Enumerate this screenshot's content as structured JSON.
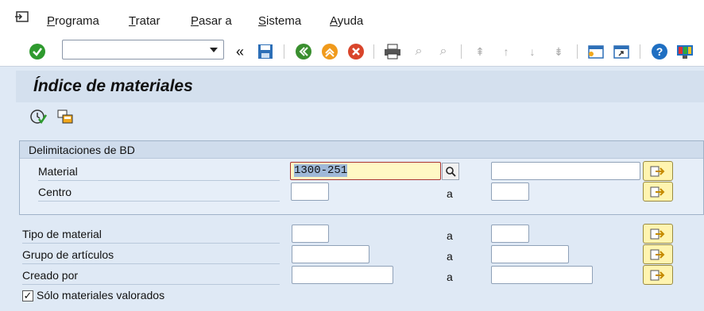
{
  "menu": {
    "items": [
      {
        "label": "Programa"
      },
      {
        "label": "Tratar"
      },
      {
        "label": "Pasar a"
      },
      {
        "label": "Sistema"
      },
      {
        "label": "Ayuda"
      }
    ]
  },
  "toolbar": {
    "command_field_value": "",
    "icons": [
      "enter-icon",
      "back-double-icon",
      "save-icon",
      "back-icon",
      "exit-icon",
      "cancel-icon",
      "print-icon",
      "find-icon",
      "find-next-icon",
      "first-page-icon",
      "previous-page-icon",
      "next-page-icon",
      "last-page-icon",
      "new-session-icon",
      "shortcut-icon",
      "help-icon",
      "customize-layout-icon"
    ]
  },
  "header": {
    "title": "Índice de materiales"
  },
  "app_toolbar": {
    "icons": [
      "execute-icon",
      "get-variant-icon"
    ]
  },
  "selection": {
    "group_title": "Delimitaciones de BD",
    "rows": [
      {
        "label": "Material",
        "from_value": "1300-251",
        "to_label": "",
        "to_value": ""
      },
      {
        "label": "Centro",
        "from_value": "",
        "to_label": "a",
        "to_value": ""
      },
      {
        "label": "Tipo de material",
        "from_value": "",
        "to_label": "a",
        "to_value": ""
      },
      {
        "label": "Grupo de artículos",
        "from_value": "",
        "to_label": "a",
        "to_value": ""
      },
      {
        "label": "Creado por",
        "from_value": "",
        "to_label": "a",
        "to_value": ""
      }
    ],
    "checkbox": {
      "label": "Sólo materiales valorados",
      "checked": "✓"
    }
  },
  "colors": {
    "background": "#dfe9f5",
    "active_field": "#fff8c4",
    "multiple_selection_button": "#fff4b0",
    "enter_icon": "#2e9a2e",
    "help_icon": "#1f6fc2"
  }
}
